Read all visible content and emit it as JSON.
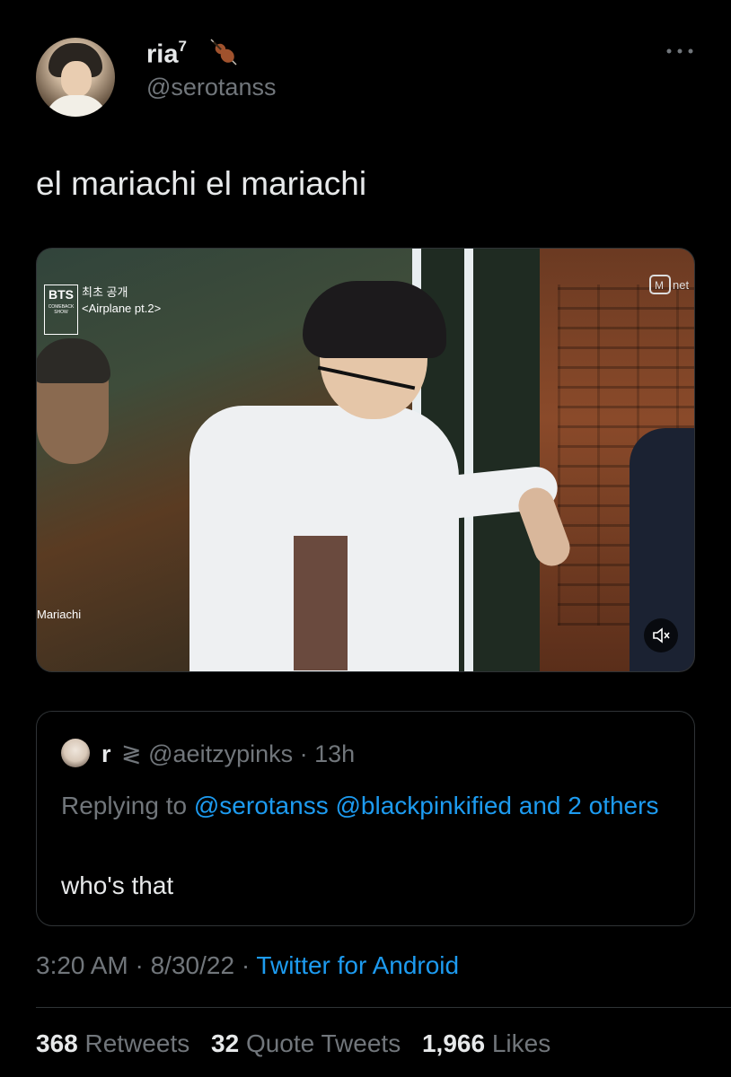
{
  "author": {
    "name": "ria",
    "name_superscript": "7",
    "handle": "@serotanss",
    "badge_icon": "violin-icon"
  },
  "tweet": {
    "text": "el mariachi el mariachi"
  },
  "media": {
    "overlay_logo": "BTS",
    "overlay_logo_sub": "COMEBACK SHOW",
    "overlay_title_line1": "최초 공개",
    "overlay_title_line2": "<Airplane pt.2>",
    "caption_left": "Mariachi",
    "channel_logo": "Mnet",
    "mute_icon": "mute-icon"
  },
  "quoted": {
    "name": "r",
    "handle_line": "≷ @aeitzypinks · 13h",
    "replying_prefix": "Replying to",
    "replying_users": "@serotanss @blackpinkified and 2 others",
    "text": "who's that"
  },
  "meta": {
    "time": "3:20 AM · 8/30/22 ·",
    "source": "Twitter for Android"
  },
  "stats": {
    "retweets_count": "368",
    "retweets_label": "Retweets",
    "quotes_count": "32",
    "quotes_label": "Quote Tweets",
    "likes_count": "1,966",
    "likes_label": "Likes"
  },
  "colors": {
    "background": "#000000",
    "text": "#e7e9ea",
    "muted": "#71767b",
    "link": "#1d9bf0",
    "border": "#2f3336"
  }
}
